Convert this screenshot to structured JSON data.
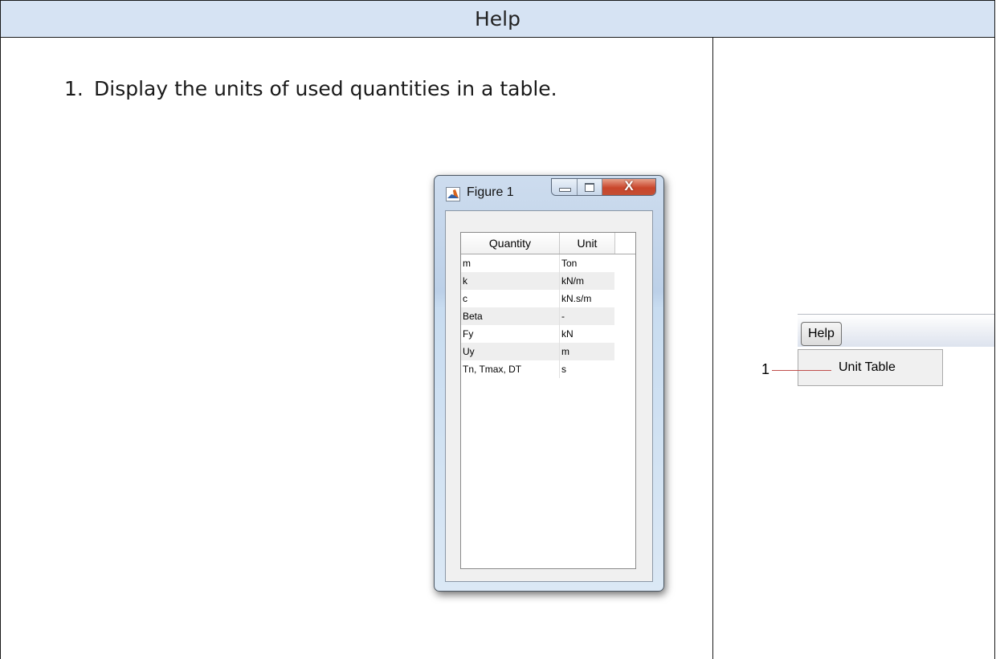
{
  "header": {
    "title": "Help"
  },
  "instructions": {
    "steps": [
      {
        "number": "1.",
        "text": "Display the units of used quantities in a table."
      }
    ]
  },
  "figure_window": {
    "title": "Figure 1",
    "close_glyph": "X",
    "table": {
      "columns": [
        "Quantity",
        "Unit"
      ],
      "rows": [
        {
          "quantity": "m",
          "unit": "Ton"
        },
        {
          "quantity": "k",
          "unit": "kN/m"
        },
        {
          "quantity": "c",
          "unit": "kN.s/m"
        },
        {
          "quantity": "Beta",
          "unit": "-"
        },
        {
          "quantity": "Fy",
          "unit": "kN"
        },
        {
          "quantity": "Uy",
          "unit": "m"
        },
        {
          "quantity": "Tn, Tmax, DT",
          "unit": "s"
        }
      ]
    }
  },
  "menu_snippet": {
    "menu_label": "Help",
    "item_label": "Unit Table",
    "callout_number": "1",
    "callout_color": "#c0504d"
  },
  "colors": {
    "header_background": "#d6e3f3",
    "border": "#1a1a1a"
  }
}
